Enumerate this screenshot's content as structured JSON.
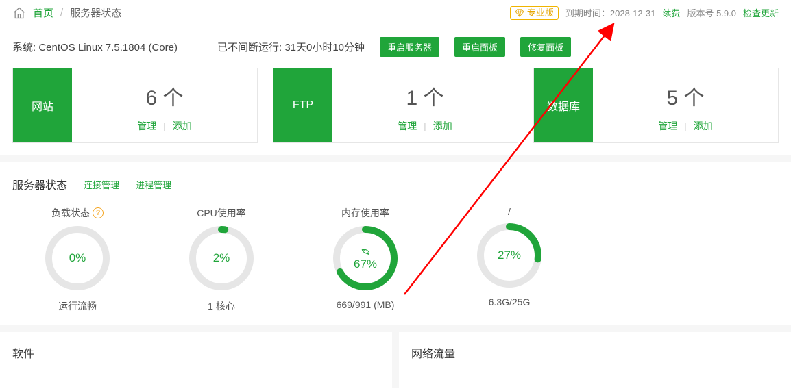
{
  "breadcrumb": {
    "home": "首页",
    "page": "服务器状态"
  },
  "top": {
    "pro_label": "专业版",
    "expire_prefix": "到期时间：",
    "expire_date": "2028-12-31",
    "renew": "续费",
    "version_prefix": "版本号 ",
    "version": "5.9.0",
    "check_update": "检查更新"
  },
  "sys": {
    "os_prefix": "系统: ",
    "os": "CentOS Linux 7.5.1804 (Core)",
    "uptime_prefix": "已不间断运行: ",
    "uptime": "31天0小时10分钟",
    "btn_restart_server": "重启服务器",
    "btn_restart_panel": "重启面板",
    "btn_repair_panel": "修复面板"
  },
  "cards": {
    "website": {
      "side": "网站",
      "count": "6 个",
      "manage": "管理",
      "add": "添加"
    },
    "ftp": {
      "side": "FTP",
      "count": "1 个",
      "manage": "管理",
      "add": "添加"
    },
    "db": {
      "side": "数据库",
      "count": "5 个",
      "manage": "管理",
      "add": "添加"
    }
  },
  "section": {
    "title": "服务器状态",
    "link_conn": "连接管理",
    "link_proc": "进程管理"
  },
  "metrics": {
    "load": {
      "title": "负载状态",
      "pct": 0,
      "pct_text": "0%",
      "sub": "运行流畅"
    },
    "cpu": {
      "title": "CPU使用率",
      "pct": 2,
      "pct_text": "2%",
      "sub": "1 核心"
    },
    "mem": {
      "title": "内存使用率",
      "pct": 67,
      "pct_text": "67%",
      "sub": "669/991 (MB)"
    },
    "disk": {
      "title": "/",
      "pct": 27,
      "pct_text": "27%",
      "sub": "6.3G/25G"
    }
  },
  "bottom": {
    "software": "软件",
    "traffic": "网络流量"
  }
}
